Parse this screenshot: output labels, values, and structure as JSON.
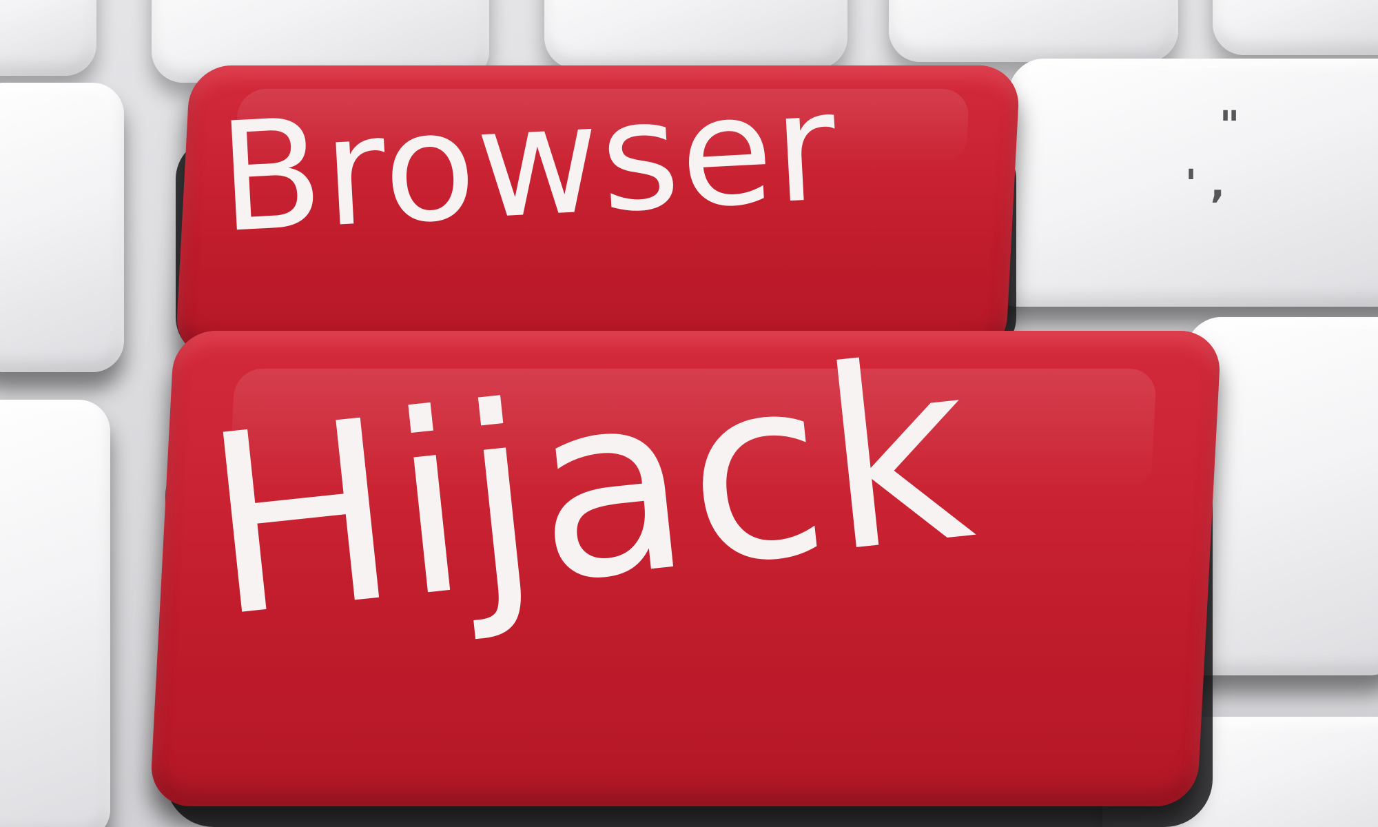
{
  "keyboard": {
    "top_key_label": "Browser",
    "bottom_key_label": "Hijack",
    "quote_key_glyph_top": "\"",
    "quote_key_glyph_bottom": "'  ,",
    "colors": {
      "red_key": "#c8202f",
      "white_key": "#f2f2f4",
      "label_text": "#f7f3f3"
    }
  }
}
